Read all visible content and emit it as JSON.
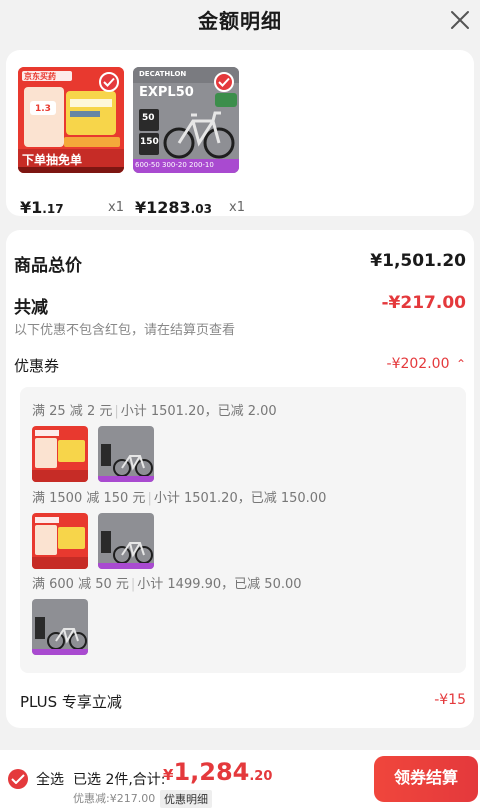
{
  "header": {
    "title": "金额明细"
  },
  "products": [
    {
      "price_symbol": "¥",
      "price_int": "1",
      "price_dec": ".17",
      "qty": "x1",
      "image": {
        "brand": "京东买药",
        "badge_top": "1.3",
        "promo_text": "下单抽免单",
        "colors": {
          "bg": "#e8392f",
          "panel": "#f7d54a"
        }
      }
    },
    {
      "price_symbol": "¥",
      "price_int": "1283",
      "price_dec": ".03",
      "qty": "x1",
      "image": {
        "brand": "DECATHLON",
        "model": "EXPL50",
        "tag1": "50",
        "tag2": "150",
        "bottom_text": "600-50 300-20 200-10",
        "colors": {
          "bg": "#8e8f94",
          "accent": "#a94ad0"
        }
      }
    }
  ],
  "summary": {
    "total_label": "商品总价",
    "total_value": "¥1,501.20",
    "reduce_label": "共减",
    "reduce_value": "-¥217.00",
    "note": "以下优惠不包含红包，请在结算页查看",
    "coupon_label": "优惠券",
    "coupon_value": "-¥202.00"
  },
  "coupon_rules": [
    {
      "condition": "满 25 减 2 元",
      "subtotal": "小计 1501.20，已减 2.00"
    },
    {
      "condition": "满 1500 减 150 元",
      "subtotal": "小计 1501.20，已减 150.00"
    },
    {
      "condition": "满 600 减 50 元",
      "subtotal": "小计 1499.90，已减 50.00"
    }
  ],
  "plus": {
    "label": "PLUS 专享立减",
    "value": "-¥15"
  },
  "footer": {
    "select_all": "全选",
    "selected_text": "已选 2件,合计:",
    "total_symbol": "¥",
    "total_int": "1,284",
    "total_dec": ".20",
    "discount_text": "优惠减:¥217.00",
    "detail_link": "优惠明细",
    "checkout_label": "领券结算"
  },
  "colors": {
    "accent": "#e4393c",
    "background": "#f2f2f2"
  }
}
